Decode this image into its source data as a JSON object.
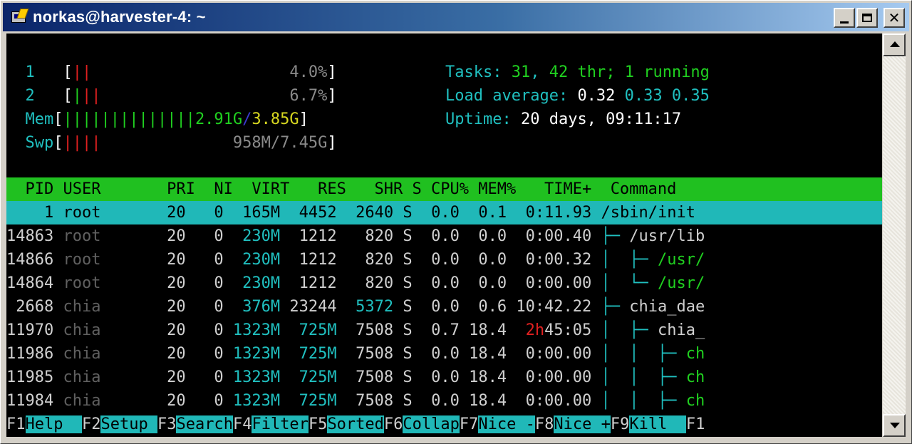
{
  "window": {
    "title": "norkas@harvester-4: ~"
  },
  "meters": {
    "cpu1": {
      "label": "1",
      "bar": "||",
      "value": "4.0%"
    },
    "cpu2": {
      "label": "2",
      "bar": "|||",
      "value": "6.7%"
    },
    "mem": {
      "label": "Mem",
      "bar": "||||||||||||||",
      "used": "2.91G",
      "sep": "/",
      "total": "3.85G"
    },
    "swp": {
      "label": "Swp",
      "bar": "||||",
      "value": "958M/7.45G"
    }
  },
  "summary": {
    "tasks_label": "Tasks: ",
    "tasks": "31",
    "comma": ", ",
    "thr": "42",
    "thr_label": " thr; ",
    "running": "1",
    "running_label": " running",
    "load_label": "Load average: ",
    "load1": "0.32",
    "load5": "0.33",
    "load15": "0.35",
    "uptime_label": "Uptime: ",
    "uptime": "20 days, 09:11:17"
  },
  "table": {
    "header": "  PID USER       PRI  NI  VIRT   RES   SHR S CPU% MEM%   TIME+  Command",
    "rows": [
      {
        "pid": "    1",
        "user": " root     ",
        "pri": "  20",
        "ni": "   0",
        "virt": "  165M",
        "res": "  4452",
        "shr": "  2640",
        "s": " S",
        "cpu": "  0.0",
        "mem": "  0.1",
        "time": "  0:11.93",
        "cmd": " /sbin/init"
      },
      {
        "pid": "14863",
        "user": " root     ",
        "pri": "  20",
        "ni": "   0",
        "virt": "  230M",
        "res": "  1212",
        "shr": "   820",
        "s": " S",
        "cpu": "  0.0",
        "mem": "  0.0",
        "time": "  0:00.40",
        "tree": " ├─ ",
        "cmd": "/usr/lib"
      },
      {
        "pid": "14866",
        "user": " root     ",
        "pri": "  20",
        "ni": "   0",
        "virt": "  230M",
        "res": "  1212",
        "shr": "   820",
        "s": " S",
        "cpu": "  0.0",
        "mem": "  0.0",
        "time": "  0:00.32",
        "tree": " │  ├─ ",
        "cmd": "/usr/"
      },
      {
        "pid": "14864",
        "user": " root     ",
        "pri": "  20",
        "ni": "   0",
        "virt": "  230M",
        "res": "  1212",
        "shr": "   820",
        "s": " S",
        "cpu": "  0.0",
        "mem": "  0.0",
        "time": "  0:00.00",
        "tree": " │  └─ ",
        "cmd": "/usr/"
      },
      {
        "pid": " 2668",
        "user": " chia     ",
        "pri": "  20",
        "ni": "   0",
        "virt": "  376M",
        "res": " 23244",
        "shr": "  5372",
        "s": " S",
        "cpu": "  0.0",
        "mem": "  0.6",
        "time": " 10:42.22",
        "tree": " ├─ ",
        "cmd": "chia_dae"
      },
      {
        "pid": "11970",
        "user": " chia     ",
        "pri": "  20",
        "ni": "   0",
        "virt": " 1323M",
        "res": "  725M",
        "shr": "  7508",
        "s": " S",
        "cpu": "  0.7",
        "mem": " 18.4",
        "time_h": "  2h",
        "time": "45:05",
        "tree": " │  ├─ ",
        "cmd": "chia_"
      },
      {
        "pid": "11986",
        "user": " chia     ",
        "pri": "  20",
        "ni": "   0",
        "virt": " 1323M",
        "res": "  725M",
        "shr": "  7508",
        "s": " S",
        "cpu": "  0.0",
        "mem": " 18.4",
        "time": "  0:00.00",
        "tree": " │  │  ├─ ",
        "cmd": "ch"
      },
      {
        "pid": "11985",
        "user": " chia     ",
        "pri": "  20",
        "ni": "   0",
        "virt": " 1323M",
        "res": "  725M",
        "shr": "  7508",
        "s": " S",
        "cpu": "  0.0",
        "mem": " 18.4",
        "time": "  0:00.00",
        "tree": " │  │  ├─ ",
        "cmd": "ch"
      },
      {
        "pid": "11984",
        "user": " chia     ",
        "pri": "  20",
        "ni": "   0",
        "virt": " 1323M",
        "res": "  725M",
        "shr": "  7508",
        "s": " S",
        "cpu": "  0.0",
        "mem": " 18.4",
        "time": "  0:00.00",
        "tree": " │  │  ├─ ",
        "cmd": "ch"
      }
    ]
  },
  "fkeys": [
    {
      "key": "F1",
      "label": "Help  "
    },
    {
      "key": "F2",
      "label": "Setup "
    },
    {
      "key": "F3",
      "label": "Search"
    },
    {
      "key": "F4",
      "label": "Filter"
    },
    {
      "key": "F5",
      "label": "Sorted"
    },
    {
      "key": "F6",
      "label": "Collap"
    },
    {
      "key": "F7",
      "label": "Nice -"
    },
    {
      "key": "F8",
      "label": "Nice +"
    },
    {
      "key": "F9",
      "label": "Kill  "
    },
    {
      "key": "F1",
      "label": ""
    }
  ],
  "colors": {
    "header_bg": "#20c020",
    "selected_bg": "#20b8b8",
    "cyan": "#20c0c0",
    "green": "#20d020",
    "red": "#e02020"
  }
}
